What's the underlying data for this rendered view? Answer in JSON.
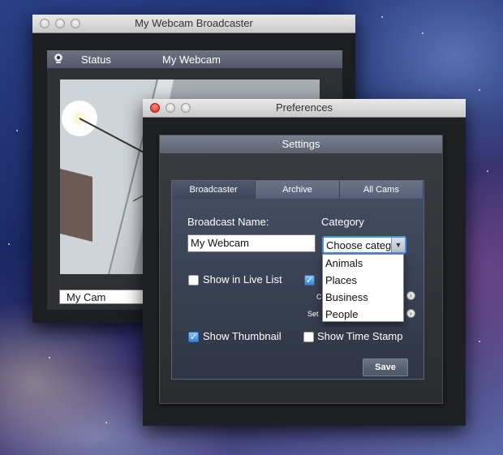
{
  "webcam_window": {
    "title": "My Webcam Broadcaster",
    "status_label": "Status",
    "cam_title": "My Webcam",
    "cam_select_value": "My Cam"
  },
  "prefs_window": {
    "title": "Preferences",
    "settings_header": "Settings",
    "tabs": [
      {
        "label": "Broadcaster",
        "active": true
      },
      {
        "label": "Archive",
        "active": false
      },
      {
        "label": "All Cams",
        "active": false
      }
    ],
    "broadcast_name_label": "Broadcast Name:",
    "broadcast_name_value": "My Webcam",
    "category_label": "Category",
    "category_value": "Choose categ",
    "category_options": [
      "Animals",
      "Places",
      "Business",
      "People"
    ],
    "show_live_list": {
      "label": "Show in Live List",
      "checked": false
    },
    "partial_checkbox_checked": true,
    "partial_label_1": "C",
    "partial_label_2": "Set",
    "show_thumbnail": {
      "label": "Show Thumbnail",
      "checked": true
    },
    "show_time_stamp": {
      "label": "Show Time Stamp",
      "checked": false
    },
    "save_label": "Save"
  }
}
